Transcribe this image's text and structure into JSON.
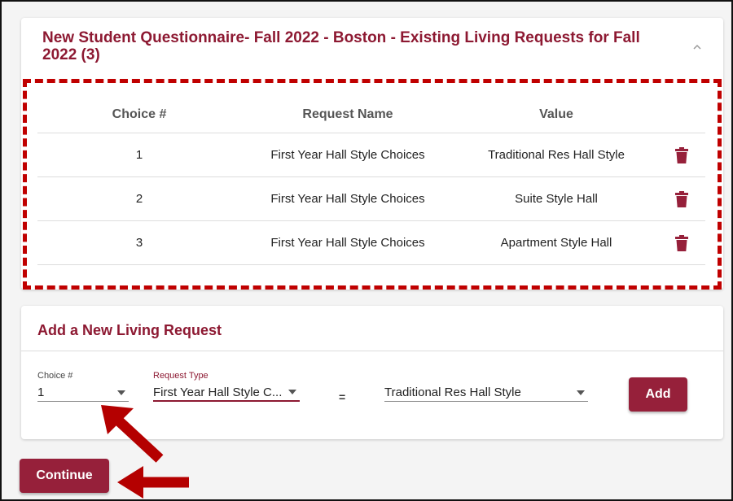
{
  "questionnaire": {
    "title": "New Student Questionnaire- Fall 2022 - Boston - Existing Living Requests for Fall 2022 (3)",
    "collapse_icon": "chevron-up-icon",
    "columns": [
      "Choice #",
      "Request Name",
      "Value"
    ],
    "rows": [
      {
        "choice": "1",
        "request_name": "First Year Hall Style Choices",
        "value": "Traditional Res Hall Style"
      },
      {
        "choice": "2",
        "request_name": "First Year Hall Style Choices",
        "value": "Suite Style Hall"
      },
      {
        "choice": "3",
        "request_name": "First Year Hall Style Choices",
        "value": "Apartment Style Hall"
      }
    ],
    "row_action_icon": "trash-icon"
  },
  "add_request": {
    "title": "Add a New Living Request",
    "choice_field": {
      "label": "Choice #",
      "value": "1"
    },
    "request_type_field": {
      "label": "Request Type",
      "value": "First Year Hall Style C..."
    },
    "equals": "=",
    "value_field": {
      "value": "Traditional Res Hall Style"
    },
    "add_label": "Add"
  },
  "continue_label": "Continue",
  "colors": {
    "brand": "#96203a",
    "title": "#8d1932",
    "highlight": "#c00000"
  }
}
